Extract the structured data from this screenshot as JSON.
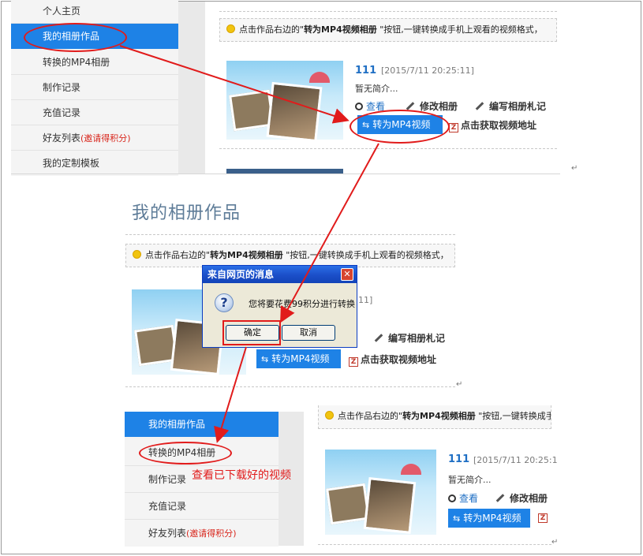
{
  "sidebar_top": {
    "items": [
      {
        "label": "个人主页"
      },
      {
        "label": "我的相册作品"
      },
      {
        "label": "转换的MP4相册"
      },
      {
        "label": "制作记录"
      },
      {
        "label": "充值记录"
      },
      {
        "label": "好友列表",
        "suffix": "(邀请得积分)"
      },
      {
        "label": "我的定制模板"
      }
    ]
  },
  "sidebar_bottom": {
    "items": [
      {
        "label": "我的相册作品"
      },
      {
        "label": "转换的MP4相册"
      },
      {
        "label": "制作记录"
      },
      {
        "label": "充值记录"
      },
      {
        "label": "好友列表",
        "suffix": "(邀请得积分)"
      }
    ]
  },
  "tip": {
    "prefix": "点击作品右边的\"",
    "bold": "转为MP4视频相册",
    "suffix": " \"按钮,一键转换成手机上观看的视频格式，"
  },
  "album": {
    "title": "111",
    "date": "[2015/7/11 20:25:11]",
    "intro": "暂无简介...",
    "view_label": "查看",
    "edit_label": "修改相册",
    "note_label": "编写相册札记",
    "mp4_label": "转为MP4视频",
    "video_url_label": "点击获取视频地址"
  },
  "middle": {
    "heading": "我的相册作品",
    "date_fragment": "11]"
  },
  "bottom": {
    "date": "[2015/7/11 20:25:1"
  },
  "dialog": {
    "title": "来自网页的消息",
    "close_glyph": "✕",
    "question_glyph": "?",
    "message": "您将要花费99积分进行转换",
    "ok_label": "确定",
    "cancel_label": "取消"
  },
  "annotation": {
    "note": "查看已下载好的视频"
  },
  "icons": {
    "convert_glyph": "⇆",
    "video_glyph": "Z",
    "return_glyph": "↵"
  },
  "colors": {
    "accent_blue": "#1e82e6",
    "annotation_red": "#e11b1b",
    "invite_red": "#d8261c"
  }
}
